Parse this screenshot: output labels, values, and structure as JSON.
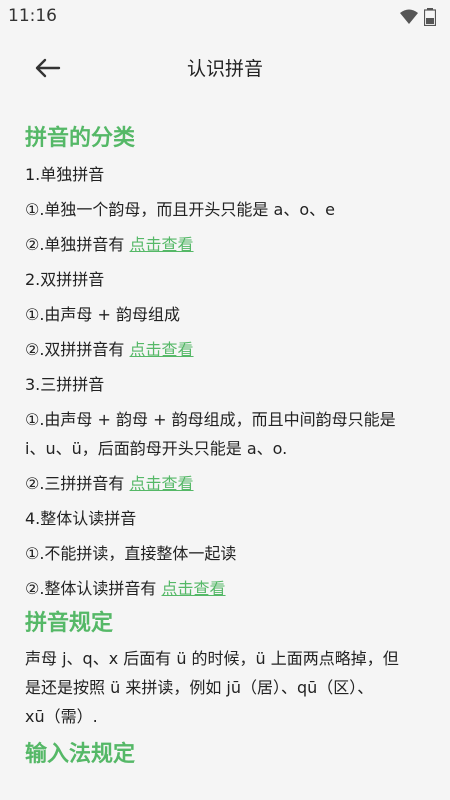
{
  "status": {
    "time": "11:16"
  },
  "header": {
    "title": "认识拼音"
  },
  "sections": [
    {
      "heading": "拼音的分类",
      "items": [
        {
          "text": "1.单独拼音"
        },
        {
          "text": "①.单独一个韵母，而且开头只能是 a、o、e"
        },
        {
          "text": "②.单独拼音有 ",
          "link": "点击查看"
        },
        {
          "text": "2.双拼拼音"
        },
        {
          "text": "①.由声母 + 韵母组成"
        },
        {
          "text": "②.双拼拼音有 ",
          "link": "点击查看"
        },
        {
          "text": "3.三拼拼音"
        },
        {
          "text": "①.由声母 + 韵母 + 韵母组成，而且中间韵母只能是"
        },
        {
          "text": "i、u、ü，后面韵母开头只能是 a、o."
        },
        {
          "text": "②.三拼拼音有 ",
          "link": "点击查看"
        },
        {
          "text": "4.整体认读拼音"
        },
        {
          "text": "①.不能拼读，直接整体一起读"
        },
        {
          "text": "②.整体认读拼音有 ",
          "link": "点击查看"
        }
      ]
    },
    {
      "heading": "拼音规定",
      "paragraph_lines": [
        "声母 j、q、x 后面有 ü 的时候，ü 上面两点略掉，但",
        "是还是按照 ü 来拼读，例如 jū（居）、qū（区）、",
        "xū（需）."
      ]
    },
    {
      "heading": "输入法规定"
    }
  ]
}
